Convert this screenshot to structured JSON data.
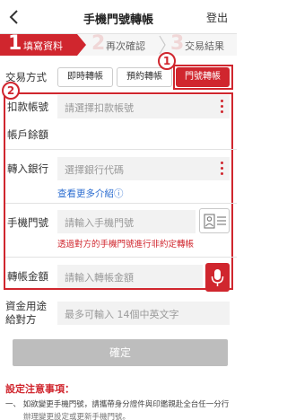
{
  "header": {
    "title": "手機門號轉帳",
    "logout_label": "登出"
  },
  "steps": [
    {
      "num": "1",
      "label": "填寫資料"
    },
    {
      "num": "2",
      "label": "再次確認"
    },
    {
      "num": "3",
      "label": "交易結果"
    }
  ],
  "method": {
    "label": "交易方式",
    "options": [
      "即時轉帳",
      "預約轉帳",
      "門號轉帳"
    ],
    "selected": "門號轉帳"
  },
  "annotations": {
    "badge1": "1",
    "badge2": "2"
  },
  "form": {
    "debit_account": {
      "label": "扣款帳號",
      "placeholder": "請選擇扣款帳號"
    },
    "balance": {
      "label": "帳戶餘額"
    },
    "bank": {
      "label": "轉入銀行",
      "placeholder": "選擇銀行代碼"
    },
    "more_link": "查看更多介紹ⓘ",
    "phone": {
      "label": "手機門號",
      "placeholder": "請輸入手機門號",
      "warning": "透過對方的手機門號進行非約定轉帳"
    },
    "amount": {
      "label": "轉帳金額",
      "placeholder": "請輸入轉帳金額"
    },
    "purpose": {
      "label_line1": "資金用途",
      "label_line2": "給對方",
      "placeholder": "最多可輸入 14個中英文字"
    }
  },
  "confirm_label": "確定",
  "notice": {
    "title": "設定注意事項：",
    "line1": "一、 如欲變更手機門號，請攜帶身分證件與印鑑親赴全台任一分行",
    "line2": "辦理變更設定或更新手機門號。"
  },
  "colors": {
    "accent": "#d0262e",
    "link": "#2f6fd1"
  }
}
